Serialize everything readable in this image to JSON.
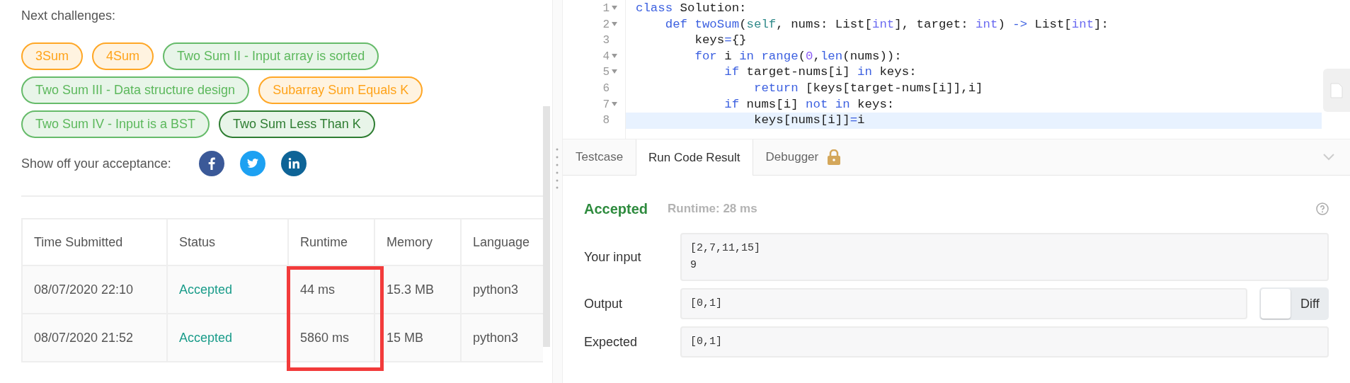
{
  "challenges": {
    "title": "Next challenges:",
    "tags": [
      {
        "label": "3Sum",
        "kind": "medium",
        "selected": false
      },
      {
        "label": "4Sum",
        "kind": "medium",
        "selected": false
      },
      {
        "label": "Two Sum II - Input array is sorted",
        "kind": "easy",
        "selected": false
      },
      {
        "label": "Two Sum III - Data structure design",
        "kind": "easy",
        "selected": false
      },
      {
        "label": "Subarray Sum Equals K",
        "kind": "medium",
        "selected": false
      },
      {
        "label": "Two Sum IV - Input is a BST",
        "kind": "easy",
        "selected": false
      },
      {
        "label": "Two Sum Less Than K",
        "kind": "easy",
        "selected": true
      }
    ]
  },
  "share": {
    "label": "Show off your acceptance:",
    "networks": [
      {
        "kind": "facebook"
      },
      {
        "kind": "twitter"
      },
      {
        "kind": "linkedin"
      }
    ]
  },
  "submissions": {
    "columns": [
      {
        "label": "Time Submitted",
        "highlighted": false
      },
      {
        "label": "Status",
        "highlighted": false
      },
      {
        "label": "Runtime",
        "highlighted": true
      },
      {
        "label": "Memory",
        "highlighted": false
      },
      {
        "label": "Language",
        "highlighted": false
      }
    ],
    "rows": [
      {
        "cells": [
          "08/07/2020 22:10",
          "Accepted",
          "44 ms",
          "15.3 MB",
          "python3"
        ]
      },
      {
        "cells": [
          "08/07/2020 21:52",
          "Accepted",
          "5860 ms",
          "15 MB",
          "python3"
        ]
      }
    ]
  },
  "editor": {
    "lines": [
      {
        "number": "1",
        "foldable": true,
        "current": false,
        "tokens": [
          {
            "text": "class",
            "kind": "keyword"
          },
          {
            "text": " Solution:",
            "kind": "plain"
          }
        ]
      },
      {
        "number": "2",
        "foldable": true,
        "current": false,
        "tokens": [
          {
            "text": "    def",
            "kind": "keyword"
          },
          {
            "text": " twoSum",
            "kind": "keyword"
          },
          {
            "text": "(",
            "kind": "plain"
          },
          {
            "text": "self",
            "kind": "self"
          },
          {
            "text": ", nums: List[",
            "kind": "plain"
          },
          {
            "text": "int",
            "kind": "type"
          },
          {
            "text": "], target: ",
            "kind": "plain"
          },
          {
            "text": "int",
            "kind": "type"
          },
          {
            "text": ") ",
            "kind": "plain"
          },
          {
            "text": "->",
            "kind": "keyword"
          },
          {
            "text": " List[",
            "kind": "plain"
          },
          {
            "text": "int",
            "kind": "type"
          },
          {
            "text": "]:",
            "kind": "plain"
          }
        ]
      },
      {
        "number": "3",
        "foldable": false,
        "current": false,
        "tokens": [
          {
            "text": "        keys",
            "kind": "plain"
          },
          {
            "text": "=",
            "kind": "keyword"
          },
          {
            "text": "{}",
            "kind": "plain"
          }
        ]
      },
      {
        "number": "4",
        "foldable": true,
        "current": false,
        "tokens": [
          {
            "text": "        for",
            "kind": "keyword"
          },
          {
            "text": " i ",
            "kind": "plain"
          },
          {
            "text": "in",
            "kind": "keyword"
          },
          {
            "text": " range",
            "kind": "keyword"
          },
          {
            "text": "(",
            "kind": "plain"
          },
          {
            "text": "0",
            "kind": "number"
          },
          {
            "text": ",",
            "kind": "plain"
          },
          {
            "text": "len",
            "kind": "keyword"
          },
          {
            "text": "(nums)):",
            "kind": "plain"
          }
        ]
      },
      {
        "number": "5",
        "foldable": true,
        "current": false,
        "tokens": [
          {
            "text": "            if",
            "kind": "keyword"
          },
          {
            "text": " target-nums[i] ",
            "kind": "plain"
          },
          {
            "text": "in",
            "kind": "keyword"
          },
          {
            "text": " keys:",
            "kind": "plain"
          }
        ]
      },
      {
        "number": "6",
        "foldable": false,
        "current": false,
        "tokens": [
          {
            "text": "                return",
            "kind": "keyword"
          },
          {
            "text": " [keys[target-nums[i]],i]",
            "kind": "plain"
          }
        ]
      },
      {
        "number": "7",
        "foldable": true,
        "current": false,
        "tokens": [
          {
            "text": "            if",
            "kind": "keyword"
          },
          {
            "text": " nums[i] ",
            "kind": "plain"
          },
          {
            "text": "not in",
            "kind": "keyword"
          },
          {
            "text": " keys:",
            "kind": "plain"
          }
        ]
      },
      {
        "number": "8",
        "foldable": false,
        "current": true,
        "tokens": [
          {
            "text": "                keys[nums[i]]",
            "kind": "plain"
          },
          {
            "text": "=",
            "kind": "keyword"
          },
          {
            "text": "i",
            "kind": "plain"
          }
        ]
      }
    ]
  },
  "console": {
    "tabs": [
      {
        "label": "Testcase",
        "selected": false,
        "locked": false
      },
      {
        "label": "Run Code Result",
        "selected": true,
        "locked": false
      },
      {
        "label": "Debugger",
        "selected": false,
        "locked": true
      }
    ],
    "result": {
      "status": "Accepted",
      "runtime": "Runtime: 28 ms",
      "fields": [
        {
          "label": "Your input",
          "lines": [
            "[2,7,11,15]",
            "9"
          ]
        },
        {
          "label": "Output",
          "lines": [
            "[0,1]"
          ],
          "diff": {
            "label": "Diff",
            "on": false
          }
        },
        {
          "label": "Expected",
          "lines": [
            "[0,1]"
          ]
        }
      ]
    }
  }
}
